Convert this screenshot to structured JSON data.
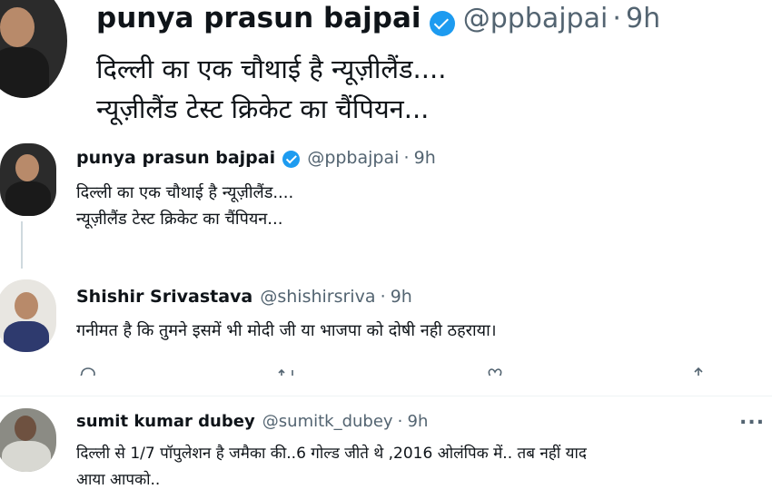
{
  "top_tweet": {
    "name": "punya prasun bajpai",
    "handle": "@ppbajpai",
    "time": "9h",
    "lines": [
      "दिल्ली का एक चौथाई है न्यूज़ीलैंड....",
      "न्यूज़ीलैंड टेस्ट क्रिकेट का चैंपियन..."
    ]
  },
  "tweet1": {
    "name": "punya prasun bajpai",
    "handle": "@ppbajpai",
    "time": "9h",
    "lines": [
      "दिल्ली का एक चौथाई है न्यूज़ीलैंड....",
      "न्यूज़ीलैंड टेस्ट क्रिकेट का चैंपियन..."
    ]
  },
  "tweet2": {
    "name": "Shishir Srivastava",
    "handle": "@shishirsriva",
    "time": "9h",
    "lines": [
      "गनीमत है कि तुमने इसमें भी मोदी जी या भाजपा को दोषी नही ठहराया।"
    ]
  },
  "tweet3": {
    "name": "sumit kumar dubey",
    "handle": "@sumitk_dubey",
    "time": "9h",
    "lines": [
      "दिल्ली से 1/7 पॉपुलेशन है जमैका की..6 गोल्ड जीते थे ,2016 ओलंपिक में.. तब नहीं याद",
      "आया आपको.."
    ],
    "more": "..."
  },
  "colors": {
    "text": "#0f1419",
    "secondary": "#536471",
    "verified": "#1d9bf0",
    "thread_line": "#cfd9de"
  }
}
